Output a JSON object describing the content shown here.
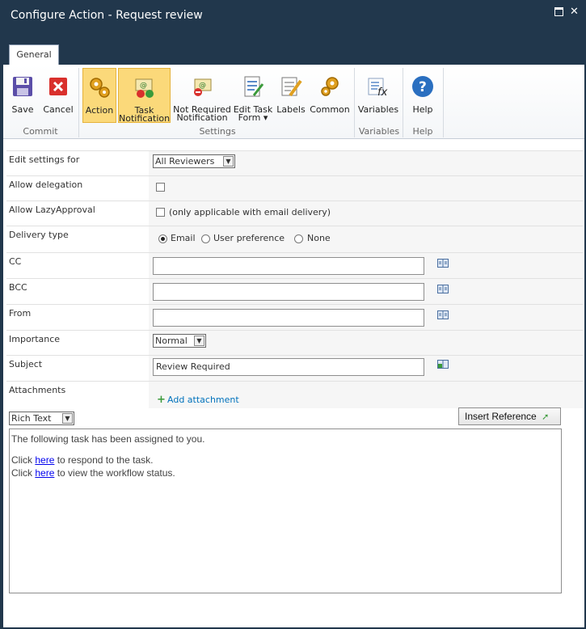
{
  "window": {
    "title": "Configure Action - Request review"
  },
  "tabs": [
    {
      "label": "General"
    }
  ],
  "ribbon": {
    "groups": {
      "commit": "Commit",
      "settings": "Settings",
      "variables": "Variables",
      "help": "Help"
    },
    "save": "Save",
    "cancel": "Cancel",
    "action": "Action",
    "task_notification_1": "Task",
    "task_notification_2": "Notification",
    "not_required_1": "Not Required",
    "not_required_2": "Notification",
    "edit_task_form_1": "Edit Task",
    "edit_task_form_2": "Form",
    "labels": "Labels",
    "common": "Common",
    "variables": "Variables",
    "help": "Help"
  },
  "form": {
    "edit_settings_for": {
      "label": "Edit settings for",
      "value": "All Reviewers"
    },
    "allow_delegation": {
      "label": "Allow delegation"
    },
    "allow_lazy": {
      "label": "Allow LazyApproval",
      "note": "(only applicable with email delivery)"
    },
    "delivery_type": {
      "label": "Delivery type",
      "options": [
        "Email",
        "User preference",
        "None"
      ],
      "selected": "Email"
    },
    "cc": {
      "label": "CC",
      "value": ""
    },
    "bcc": {
      "label": "BCC",
      "value": ""
    },
    "from": {
      "label": "From",
      "value": ""
    },
    "importance": {
      "label": "Importance",
      "value": "Normal"
    },
    "subject": {
      "label": "Subject",
      "value": "Review Required"
    },
    "attachments": {
      "label": "Attachments",
      "add": "Add attachment"
    }
  },
  "editor": {
    "mode": "Rich Text",
    "insert_reference": "Insert Reference",
    "line1": "The following task has been assigned to you.",
    "line2_pre": "Click ",
    "line2_link": "here",
    "line2_post": " to respond to the task.",
    "line3_pre": "Click ",
    "line3_link": "here",
    "line3_post": " to view the workflow status."
  },
  "colors": {
    "titlebar": "#21374c",
    "active_button": "#fbd97a",
    "link": "#0072bc"
  }
}
